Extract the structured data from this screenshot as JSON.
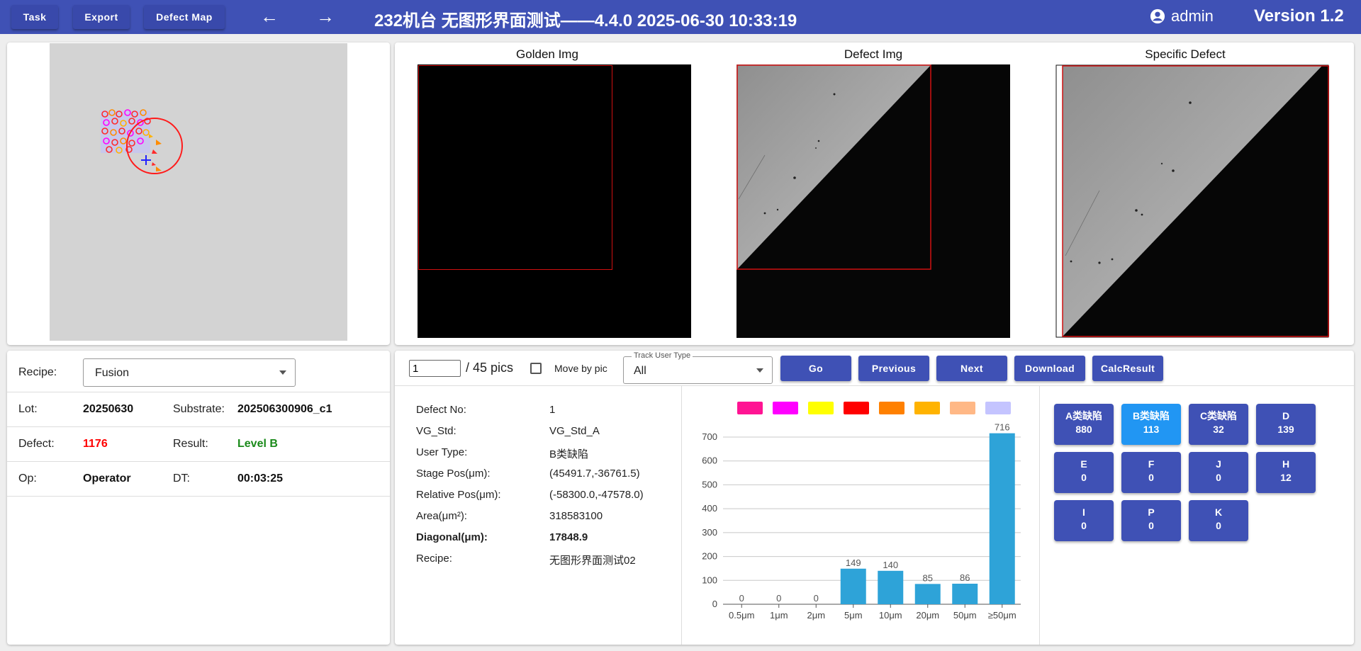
{
  "header": {
    "task": "Task",
    "export": "Export",
    "defect_map": "Defect Map",
    "title": "232机台   无图形界面测试——4.4.0   2025-06-30 10:33:19",
    "user": "admin",
    "version": "Version 1.2"
  },
  "images": {
    "golden": "Golden Img",
    "defect": "Defect Img",
    "specific": "Specific Defect"
  },
  "info": {
    "recipe_label": "Recipe:",
    "recipe_value": "Fusion",
    "lot_label": "Lot:",
    "lot_value": "20250630",
    "substrate_label": "Substrate:",
    "substrate_value": "202506300906_c1",
    "defect_label": "Defect:",
    "defect_value": "1176",
    "result_label": "Result:",
    "result_value": "Level B",
    "op_label": "Op:",
    "op_value": "Operator",
    "dt_label": "DT:",
    "dt_value": "00:03:25"
  },
  "controls": {
    "page_value": "1",
    "page_total": "/ 45 pics",
    "move_by_pic": "Move by pic",
    "track_label": "Track User Type",
    "track_value": "All",
    "go": "Go",
    "previous": "Previous",
    "next": "Next",
    "download": "Download",
    "calc": "CalcResult"
  },
  "details": [
    {
      "label": "Defect No:",
      "value": "1",
      "bold": false
    },
    {
      "label": "VG_Std:",
      "value": "VG_Std_A",
      "bold": false
    },
    {
      "label": "User Type:",
      "value": "B类缺陷",
      "bold": false
    },
    {
      "label": "Stage Pos(μm):",
      "value": "(45491.7,-36761.5)",
      "bold": false
    },
    {
      "label": "Relative Pos(μm):",
      "value": "(-58300.0,-47578.0)",
      "bold": false
    },
    {
      "label": "Area(μm²):",
      "value": "318583100",
      "bold": false
    },
    {
      "label": "Diagonal(μm):",
      "value": "17848.9",
      "bold": true
    },
    {
      "label": "Recipe:",
      "value": "无图形界面测试02",
      "bold": false
    }
  ],
  "chart_data": {
    "type": "bar",
    "categories": [
      "0.5μm",
      "1μm",
      "2μm",
      "5μm",
      "10μm",
      "20μm",
      "50μm",
      "≥50μm"
    ],
    "values": [
      0,
      0,
      0,
      149,
      140,
      85,
      86,
      716
    ],
    "yticks": [
      0,
      100,
      200,
      300,
      400,
      500,
      600,
      700
    ],
    "ylim": [
      0,
      740
    ],
    "grid": true,
    "bar_color": "#2ea3d8",
    "legend_colors": [
      "#ff1493",
      "#ff00ff",
      "#ffff00",
      "#ff0000",
      "#ff8000",
      "#ffb300",
      "#ffb886",
      "#c4c4ff"
    ]
  },
  "categories": [
    {
      "name": "A类缺陷",
      "count": "880",
      "active": false
    },
    {
      "name": "B类缺陷",
      "count": "113",
      "active": true
    },
    {
      "name": "C类缺陷",
      "count": "32",
      "active": false
    },
    {
      "name": "D",
      "count": "139",
      "active": false
    },
    {
      "name": "E",
      "count": "0",
      "active": false
    },
    {
      "name": "F",
      "count": "0",
      "active": false
    },
    {
      "name": "J",
      "count": "0",
      "active": false
    },
    {
      "name": "H",
      "count": "12",
      "active": false
    },
    {
      "name": "I",
      "count": "0",
      "active": false
    },
    {
      "name": "P",
      "count": "0",
      "active": false
    },
    {
      "name": "K",
      "count": "0",
      "active": false
    }
  ],
  "colors": {
    "primary": "#3f51b5",
    "active": "#2196f3",
    "defect_red": "#ff0000",
    "result_green": "#1a8a1a"
  }
}
